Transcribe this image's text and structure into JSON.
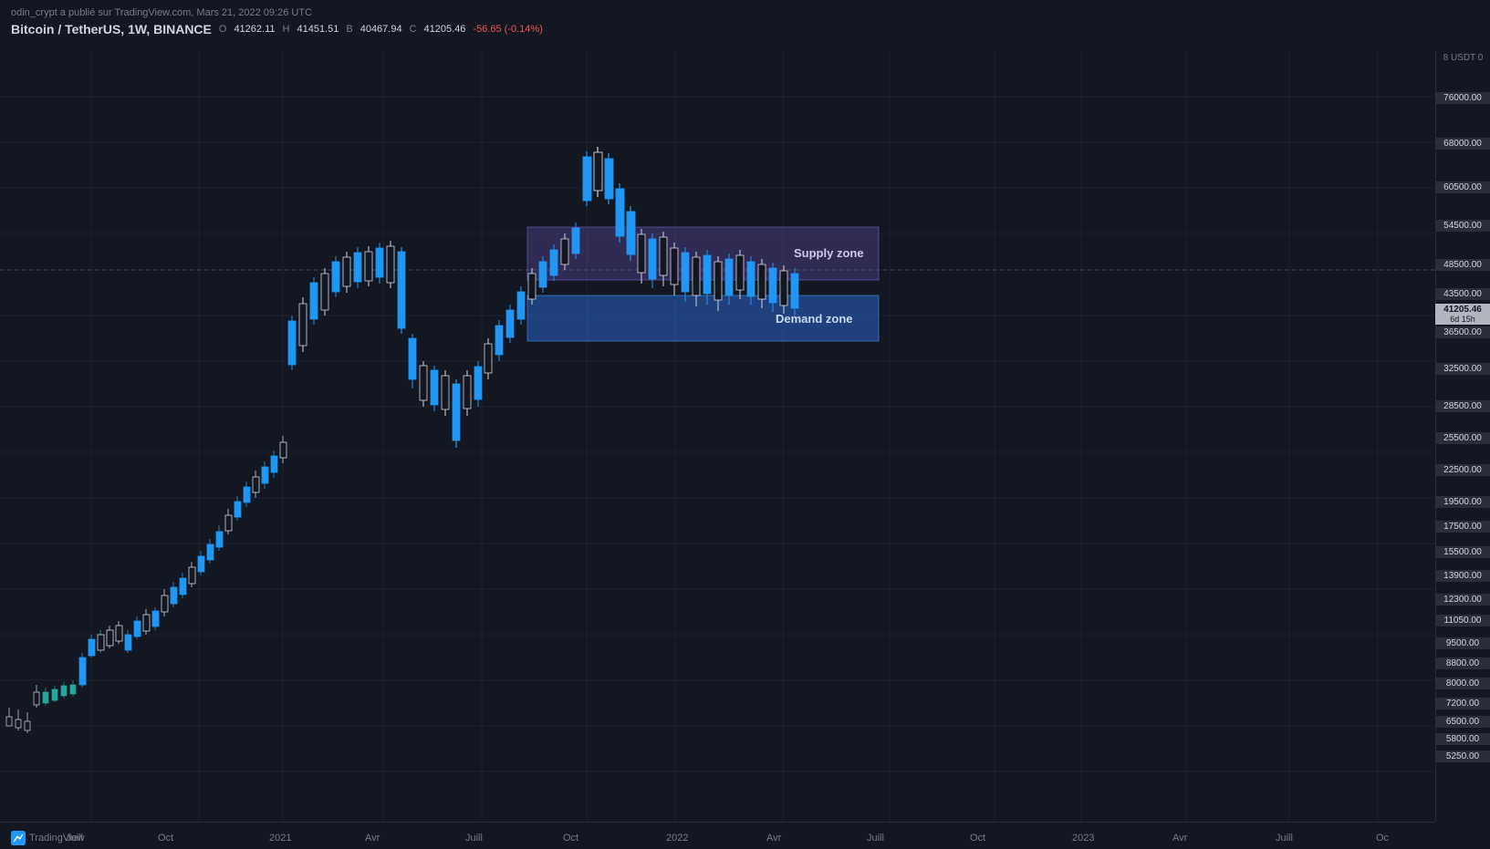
{
  "attribution": "odin_crypt a publié sur TradingView.com, Mars 21, 2022 09:26 UTC",
  "ticker": {
    "name": "Bitcoin / TetherUS, 1W, BINANCE",
    "open_label": "O",
    "open_value": "41262.11",
    "high_label": "H",
    "high_value": "41451.51",
    "low_label": "B",
    "low_value": "40467.94",
    "close_label": "C",
    "close_value": "41205.46",
    "change": "-56.65 (-0.14%)"
  },
  "price_labels": {
    "usdt": "8 USDT 0",
    "76000": "76000.00",
    "68000": "68000.00",
    "60500": "60500.00",
    "54500": "54500.00",
    "48500": "48500.00",
    "43500": "43500.00",
    "current": "41205.46",
    "current_sub": "6d 15h",
    "36500": "36500.00",
    "32500": "32500.00",
    "28500": "28500.00",
    "25500": "25500.00",
    "22500": "22500.00",
    "19500": "19500.00",
    "17500": "17500.00",
    "15500": "15500.00",
    "13900": "13900.00",
    "12300": "12300.00",
    "11050": "11050.00",
    "9500": "9500.00",
    "8800": "8800.00",
    "8000": "8000.00",
    "7200": "7200.00",
    "6500": "6500.00",
    "5800": "5800.00",
    "5250": "5250.00"
  },
  "zones": {
    "supply_label": "Supply zone",
    "demand_label": "Demand zone"
  },
  "x_axis_labels": [
    "Juill",
    "Oct",
    "2021",
    "Avr",
    "Juill",
    "Oct",
    "2022",
    "Avr",
    "Juill",
    "Oct",
    "2023",
    "Avr",
    "Juill",
    "Oc"
  ],
  "tradingview_label": "TradingView"
}
